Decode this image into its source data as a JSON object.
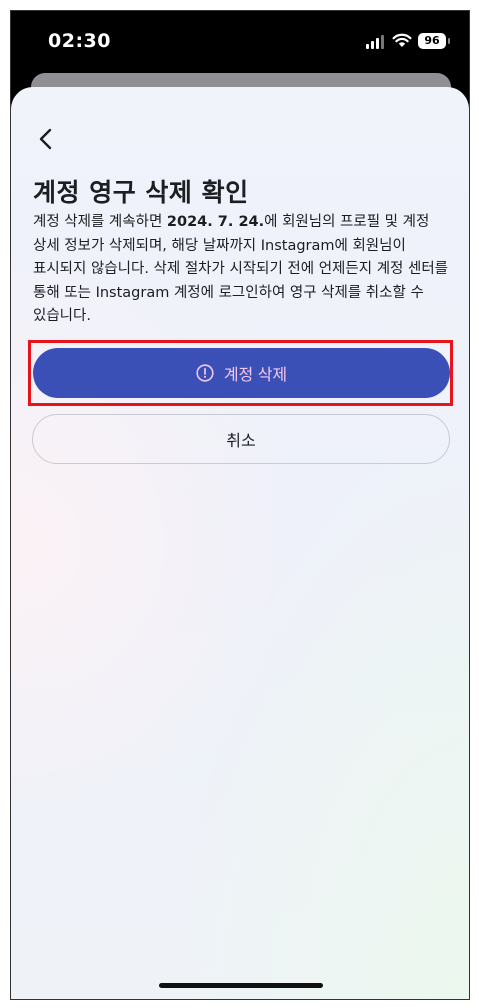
{
  "status_bar": {
    "time": "02:30",
    "battery": "96"
  },
  "screen": {
    "title": "계정 영구 삭제 확인",
    "body": {
      "before_date": "계정 삭제를 계속하면 ",
      "date": "2024. 7. 24.",
      "after_date": "에 회원님의 프로필 및 계정 상세 정보가 삭제되며, 해당 날짜까지 Instagram에 회원님이 표시되지 않습니다. 삭제 절차가 시작되기 전에 언제든지 계정 센터를 통해 또는 Instagram 계정에 로그인하여 영구 삭제를 취소할 수 있습니다."
    },
    "delete_label": "계정 삭제",
    "cancel_label": "취소"
  },
  "colors": {
    "primary_button": "#3b50b7",
    "primary_button_text": "#f4c8ef",
    "highlight_border": "#e8141c"
  },
  "icons": {
    "back": "chevron-left-icon",
    "delete": "alert-circle-icon"
  }
}
